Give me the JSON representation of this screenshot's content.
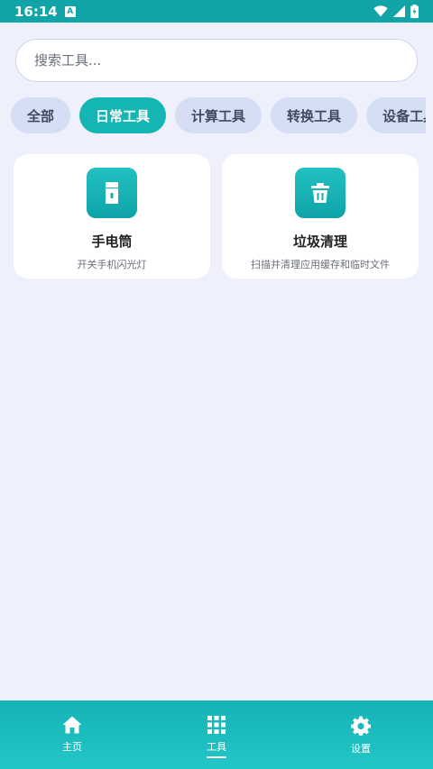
{
  "status_bar": {
    "time": "16:14",
    "notification_icon": "a-icon",
    "wifi": "wifi-icon",
    "signal": "signal-icon",
    "battery": "battery-charging-icon"
  },
  "search": {
    "placeholder": "搜索工具...",
    "value": ""
  },
  "tabs": [
    {
      "label": "全部",
      "active": false
    },
    {
      "label": "日常工具",
      "active": true
    },
    {
      "label": "计算工具",
      "active": false
    },
    {
      "label": "转换工具",
      "active": false
    },
    {
      "label": "设备工具",
      "active": false
    }
  ],
  "cards": [
    {
      "title": "手电筒",
      "desc": "开关手机闪光灯",
      "icon": "flashlight-icon"
    },
    {
      "title": "垃圾清理",
      "desc": "扫描并清理应用缓存和临时文件",
      "icon": "trash-icon"
    }
  ],
  "bottom_nav": [
    {
      "label": "主页",
      "icon": "home-icon",
      "active": false
    },
    {
      "label": "工具",
      "icon": "grid-icon",
      "active": true
    },
    {
      "label": "设置",
      "icon": "gear-icon",
      "active": false
    }
  ],
  "colors": {
    "accent": "#14b5b3",
    "background": "#eef0fb",
    "tab_inactive": "#d6def5"
  }
}
